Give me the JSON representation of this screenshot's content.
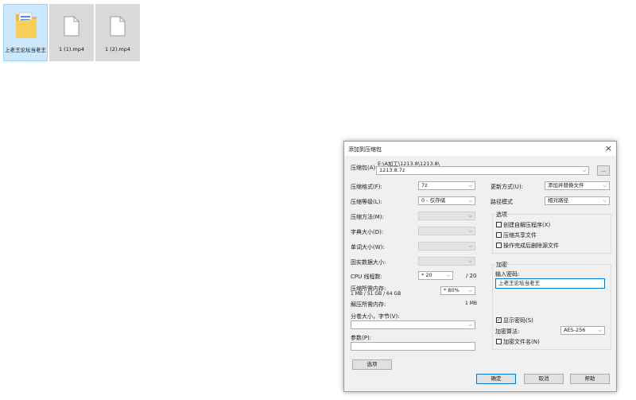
{
  "desktop": [
    {
      "label": "上老王论坛当老王",
      "type": "folder"
    },
    {
      "label": "1 (1).mp4",
      "type": "file"
    },
    {
      "label": "1 (2).mp4",
      "type": "file"
    }
  ],
  "dialog": {
    "title": "添加到压缩包",
    "archive_label": "压缩包(A):",
    "archive_path": "E:\\A加工\\1213.8\\1213.8\\",
    "archive_name": "1213.8.7z",
    "browse_label": "...",
    "format_label": "压缩格式(F):",
    "format_value": "7z",
    "level_label": "压缩等级(L):",
    "level_value": "0 - 仅存储",
    "method_label": "压缩方法(M):",
    "dict_label": "字典大小(D):",
    "word_label": "单词大小(W):",
    "solid_label": "固实数据大小:",
    "cpu_label": "CPU 线程数:",
    "cpu_value": "* 20",
    "cpu_total": "/ 20",
    "mem_label": "压缩所需内存:",
    "mem_detail": "1 MB / 51 GB / 64 GB",
    "mem_percent": "* 80%",
    "decomp_label": "解压所需内存:",
    "decomp_value": "1 MB",
    "split_label": "分卷大小，字节(V):",
    "params_label": "参数(P):",
    "options_button": "选项",
    "update_label": "更新方式(U):",
    "update_value": "添加并替换文件",
    "path_label": "路径模式",
    "path_value": "相对路径",
    "options_group": "选项",
    "options": [
      {
        "label": "创建自解压程序(X)",
        "checked": false
      },
      {
        "label": "压缩共享文件",
        "checked": false
      },
      {
        "label": "操作完成后删除源文件",
        "checked": false
      }
    ],
    "encrypt_group": "加密",
    "password_label": "输入密码:",
    "password_value": "上老王论坛当老王",
    "show_pw_label": "显示密码(S)",
    "show_pw_checked": true,
    "algo_label": "加密算法:",
    "algo_value": "AES-256",
    "encrypt_names_label": "加密文件名(N)",
    "encrypt_names_checked": false,
    "ok": "确定",
    "cancel": "取消",
    "help": "帮助",
    "close_glyph": "×"
  }
}
